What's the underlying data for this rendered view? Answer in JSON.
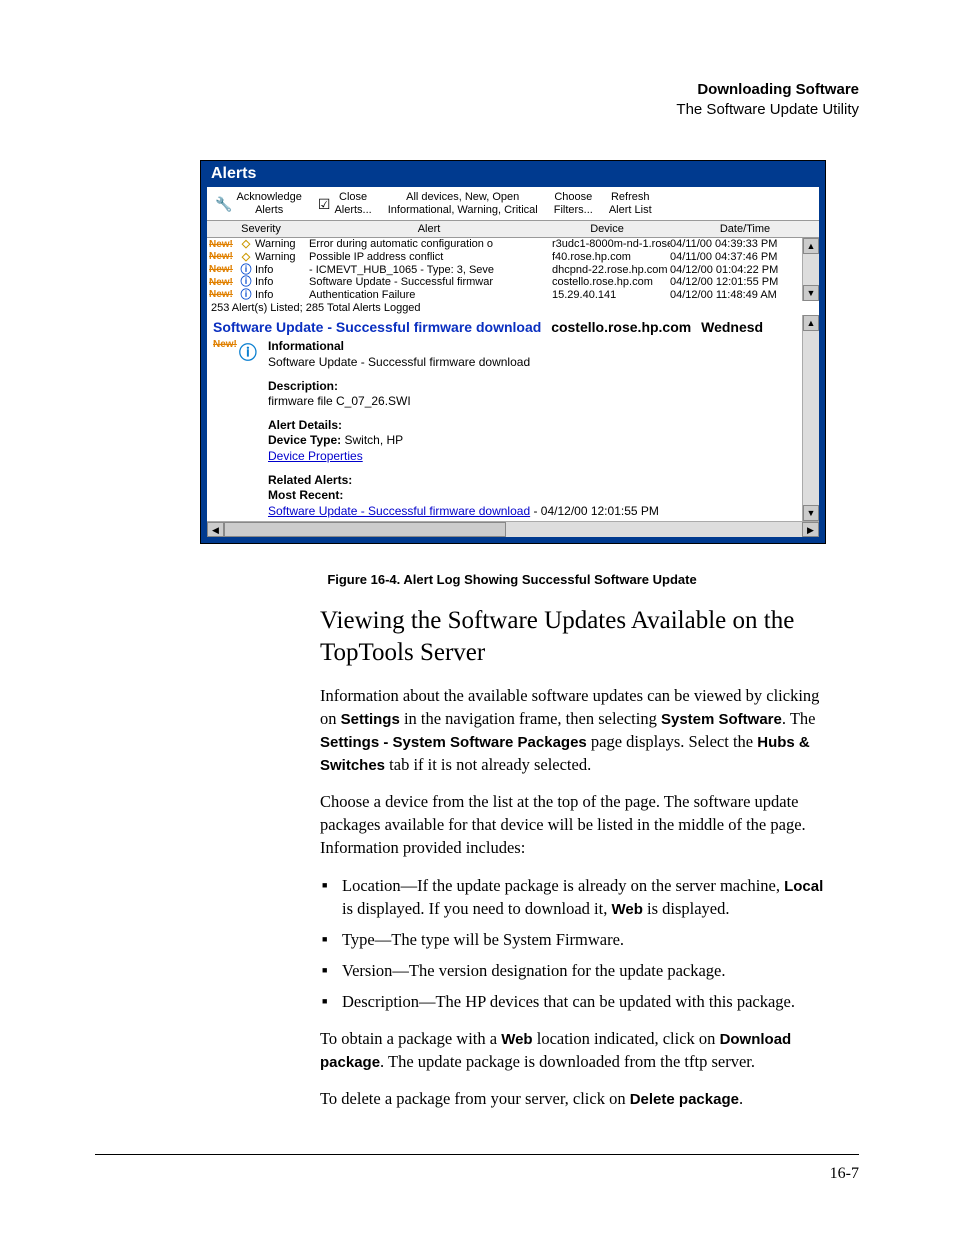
{
  "header": {
    "title_bold": "Downloading Software",
    "subtitle": "The Software Update Utility"
  },
  "alerts_window": {
    "title": "Alerts",
    "toolbar": {
      "ack": "Acknowledge\nAlerts",
      "close": "Close\nAlerts...",
      "filter_line1": "All devices, New, Open",
      "filter_line2": "Informational, Warning, Critical",
      "choose": "Choose\nFilters...",
      "refresh": "Refresh\nAlert List"
    },
    "columns": {
      "severity": "Severity",
      "alert": "Alert",
      "device": "Device",
      "datetime": "Date/Time"
    },
    "rows": [
      {
        "new": "New!",
        "type": "warn",
        "sev": "Warning",
        "alert": "Error during automatic configuration o",
        "dev": "r3udc1-8000m-nd-1.rose.",
        "dt": "04/11/00 04:39:33 PM"
      },
      {
        "new": "New!",
        "type": "warn",
        "sev": "Warning",
        "alert": "Possible IP address conflict",
        "dev": "f40.rose.hp.com",
        "dt": "04/11/00 04:37:46 PM"
      },
      {
        "new": "New!",
        "type": "info",
        "sev": "Info",
        "alert": "- ICMEVT_HUB_1065 - Type: 3, Seve",
        "dev": "dhcpnd-22.rose.hp.com",
        "dt": "04/12/00 01:04:22 PM"
      },
      {
        "new": "New!",
        "type": "info",
        "sev": "Info",
        "alert": "Software Update - Successful firmwar",
        "dev": "costello.rose.hp.com",
        "dt": "04/12/00 12:01:55 PM"
      },
      {
        "new": "New!",
        "type": "info",
        "sev": "Info",
        "alert": "Authentication Failure",
        "dev": "15.29.40.141",
        "dt": "04/12/00 11:48:49 AM"
      }
    ],
    "status": "253 Alert(s) Listed; 285 Total Alerts Logged",
    "detail": {
      "title_main": "Software Update - Successful firmware download",
      "title_host": "costello.rose.hp.com",
      "title_day": "Wednesd",
      "informational_label": "Informational",
      "informational_text": "Software Update - Successful firmware download",
      "description_label": "Description:",
      "description_text": "firmware file C_07_26.SWI",
      "details_label": "Alert Details:",
      "device_type_label": "Device Type:",
      "device_type_value": " Switch, HP",
      "device_properties_link": "Device Properties",
      "related_label": "Related Alerts:",
      "most_recent_label": "Most Recent:",
      "related_link": "Software Update - Successful firmware download",
      "related_dt": " - 04/12/00 12:01:55 PM"
    }
  },
  "caption": "Figure 16-4.  Alert Log Showing Successful Software Update",
  "body": {
    "heading": "Viewing the Software Updates Available on the TopTools Server",
    "p1_a": "Information about the available software updates can be viewed by clicking on ",
    "p1_settings": "Settings",
    "p1_b": " in the navigation frame, then selecting ",
    "p1_sys": "System Software",
    "p1_c": ". The ",
    "p1_pkg": "Settings - System Software Packages",
    "p1_d": " page displays. Select the ",
    "p1_hubs": "Hubs & Switches",
    "p1_e": " tab if it is not already selected.",
    "p2": "Choose a device from the list at the top of the page. The software update packages available for that device will be listed in the middle of the page. Information provided includes:",
    "li1_a": "Location—If the update package is already on the server machine, ",
    "li1_local": "Local",
    "li1_b": " is displayed. If you need to download it, ",
    "li1_web": "Web",
    "li1_c": " is displayed.",
    "li2": "Type—The type will be System Firmware.",
    "li3": "Version—The version designation for the update package.",
    "li4": "Description—The HP devices that can be updated with this package.",
    "p3_a": "To obtain a package with a ",
    "p3_web": "Web",
    "p3_b": " location indicated, click on ",
    "p3_dl": "Download package",
    "p3_c": ". The update package is downloaded from the tftp server.",
    "p4_a": "To delete a package from your server, click on ",
    "p4_del": "Delete package",
    "p4_b": "."
  },
  "page_number": "16-7"
}
